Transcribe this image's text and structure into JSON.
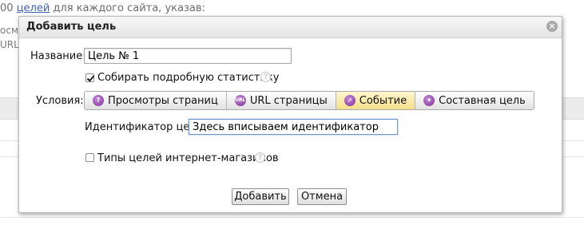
{
  "background": {
    "top_text_prefix": "00",
    "top_link": "целей",
    "top_text_suffix": "для каждого сайта, указав:",
    "side_text_1": "осм",
    "side_text_2": "URL"
  },
  "dialog": {
    "title": "Добавить цель",
    "close_symbol": "×",
    "name_label": "Название:",
    "name_value": "Цель № 1",
    "collect_stats_label": "Собирать подробную статистику",
    "collect_stats_checked": true,
    "help_symbol": "?",
    "conditions_label": "Условия:",
    "tabs": [
      {
        "label": "Просмотры страниц",
        "icon": "views-icon",
        "glyph": "?",
        "active": false
      },
      {
        "label": "URL страницы",
        "icon": "url-icon",
        "glyph": "URL",
        "active": false
      },
      {
        "label": "Событие",
        "icon": "cursor-icon",
        "glyph": "➚",
        "active": true
      },
      {
        "label": "Составная цель",
        "icon": "composite-icon",
        "glyph": "✦",
        "active": false
      }
    ],
    "goal_id_label": "Идентификатор цели:",
    "goal_id_value": "Здесь вписываем идентификатор",
    "shop_goals_label": "Типы целей интернет-магазинов",
    "shop_goals_checked": false,
    "add_button": "Добавить",
    "cancel_button": "Отмена"
  },
  "colors": {
    "link": "#3d62b1",
    "active_tab": "#f3df8a",
    "tab_icon": "#7b2d94"
  }
}
